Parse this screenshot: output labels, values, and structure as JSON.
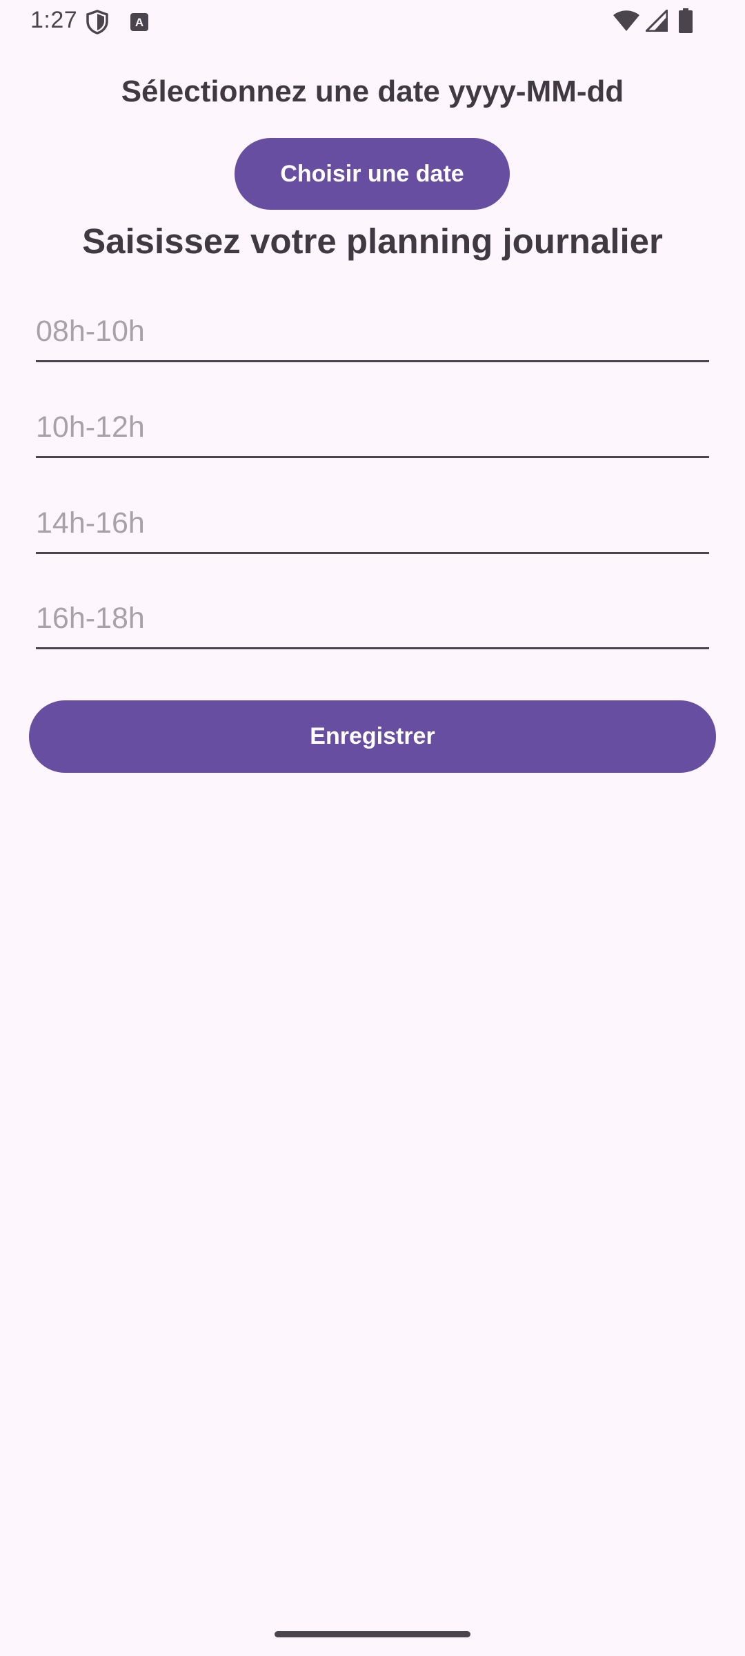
{
  "status_bar": {
    "time": "1:27",
    "icons": [
      "shield-icon",
      "keyboard-a-icon",
      "wifi-icon",
      "signal-icon",
      "battery-icon"
    ]
  },
  "date_section": {
    "heading": "Sélectionnez une date yyyy-MM-dd",
    "pick_date_label": "Choisir une date"
  },
  "planning_section": {
    "heading": "Saisissez votre planning journalier",
    "slots": [
      {
        "value": "",
        "placeholder": "08h-10h"
      },
      {
        "value": "",
        "placeholder": "10h-12h"
      },
      {
        "value": "",
        "placeholder": "14h-16h"
      },
      {
        "value": "",
        "placeholder": "16h-18h"
      }
    ],
    "save_label": "Enregistrer"
  },
  "colors": {
    "accent": "#684ea1",
    "background": "#fdf7fd",
    "text": "#3f3a42",
    "placeholder": "#a6a2a8"
  }
}
